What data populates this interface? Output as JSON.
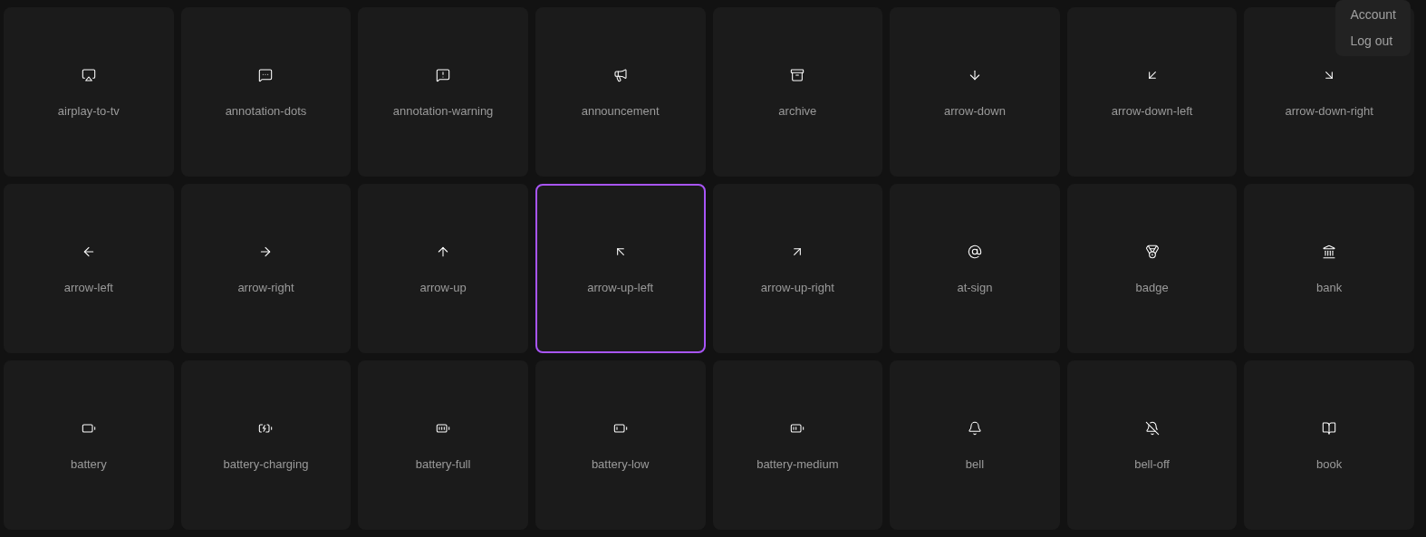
{
  "icons": [
    {
      "label": "airplay-to-tv",
      "selected": false
    },
    {
      "label": "annotation-dots",
      "selected": false
    },
    {
      "label": "annotation-warning",
      "selected": false
    },
    {
      "label": "announcement",
      "selected": false
    },
    {
      "label": "archive",
      "selected": false
    },
    {
      "label": "arrow-down",
      "selected": false
    },
    {
      "label": "arrow-down-left",
      "selected": false
    },
    {
      "label": "arrow-down-right",
      "selected": false
    },
    {
      "label": "arrow-left",
      "selected": false
    },
    {
      "label": "arrow-right",
      "selected": false
    },
    {
      "label": "arrow-up",
      "selected": false
    },
    {
      "label": "arrow-up-left",
      "selected": true
    },
    {
      "label": "arrow-up-right",
      "selected": false
    },
    {
      "label": "at-sign",
      "selected": false
    },
    {
      "label": "badge",
      "selected": false
    },
    {
      "label": "bank",
      "selected": false
    },
    {
      "label": "battery",
      "selected": false
    },
    {
      "label": "battery-charging",
      "selected": false
    },
    {
      "label": "battery-full",
      "selected": false
    },
    {
      "label": "battery-low",
      "selected": false
    },
    {
      "label": "battery-medium",
      "selected": false
    },
    {
      "label": "bell",
      "selected": false
    },
    {
      "label": "bell-off",
      "selected": false
    },
    {
      "label": "book",
      "selected": false
    }
  ],
  "menu": [
    "Account",
    "Log out"
  ]
}
